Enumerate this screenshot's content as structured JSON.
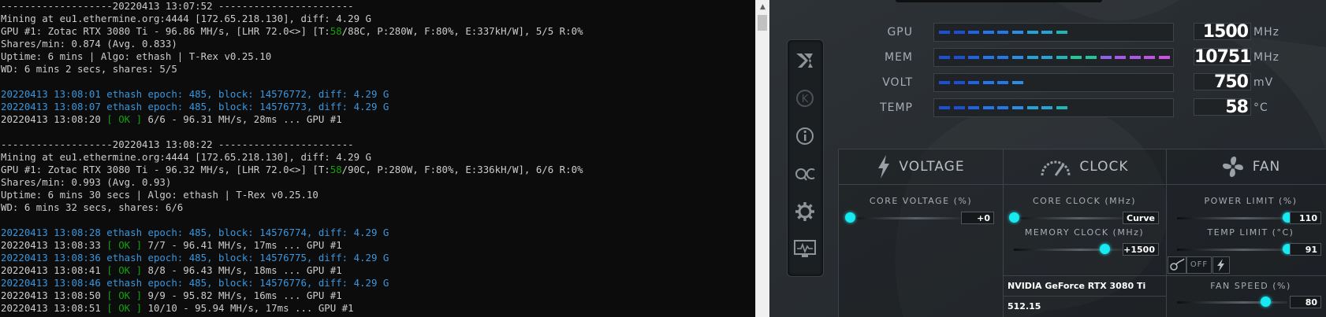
{
  "console": {
    "lines": [
      [
        [
          "w",
          "-------------------"
        ],
        [
          "w",
          "20220413 13:07:52"
        ],
        [
          "w",
          " -----------------------"
        ]
      ],
      [
        [
          "w",
          "Mining at eu1.ethermine.org:4444 [172.65.218.130], diff: 4.29 G"
        ]
      ],
      [
        [
          "w",
          "GPU #1: Zotac RTX 3080 Ti - 96.86 MH/s, [LHR 72.0<>] [T:"
        ],
        [
          "g",
          "58"
        ],
        [
          "w",
          "/88C, P:280W, F:80%, E:337kH/W], 5/5 R:0%"
        ]
      ],
      [
        [
          "w",
          "Shares/min: 0.874 (Avg. 0.833)"
        ]
      ],
      [
        [
          "w",
          "Uptime: 6 mins | Algo: ethash | T-Rex v0.25.10"
        ]
      ],
      [
        [
          "w",
          "WD: 6 mins 2 secs, shares: 5/5"
        ]
      ],
      [
        [
          "w",
          ""
        ]
      ],
      [
        [
          "c",
          "20220413 13:08:01 ethash epoch: 485, block: 14576772, diff: 4.29 G"
        ]
      ],
      [
        [
          "c",
          "20220413 13:08:07 ethash epoch: 485, block: 14576773, diff: 4.29 G"
        ]
      ],
      [
        [
          "w",
          "20220413 13:08:20 "
        ],
        [
          "g",
          "[ OK ]"
        ],
        [
          "w",
          " 6/6 - 96.31 MH/s, 28ms ... GPU #1"
        ]
      ],
      [
        [
          "w",
          ""
        ]
      ],
      [
        [
          "w",
          "-------------------"
        ],
        [
          "w",
          "20220413 13:08:22"
        ],
        [
          "w",
          " -----------------------"
        ]
      ],
      [
        [
          "w",
          "Mining at eu1.ethermine.org:4444 [172.65.218.130], diff: 4.29 G"
        ]
      ],
      [
        [
          "w",
          "GPU #1: Zotac RTX 3080 Ti - 96.32 MH/s, [LHR 72.0<>] [T:"
        ],
        [
          "g",
          "58"
        ],
        [
          "w",
          "/90C, P:280W, F:80%, E:336kH/W], 6/6 R:0%"
        ]
      ],
      [
        [
          "w",
          "Shares/min: 0.993 (Avg. 0.93)"
        ]
      ],
      [
        [
          "w",
          "Uptime: 6 mins 30 secs | Algo: ethash | T-Rex v0.25.10"
        ]
      ],
      [
        [
          "w",
          "WD: 6 mins 32 secs, shares: 6/6"
        ]
      ],
      [
        [
          "w",
          ""
        ]
      ],
      [
        [
          "c",
          "20220413 13:08:28 ethash epoch: 485, block: 14576774, diff: 4.29 G"
        ]
      ],
      [
        [
          "w",
          "20220413 13:08:33 "
        ],
        [
          "g",
          "[ OK ]"
        ],
        [
          "w",
          " 7/7 - 96.41 MH/s, 17ms ... GPU #1"
        ]
      ],
      [
        [
          "c",
          "20220413 13:08:36 ethash epoch: 485, block: 14576775, diff: 4.29 G"
        ]
      ],
      [
        [
          "w",
          "20220413 13:08:41 "
        ],
        [
          "g",
          "[ OK ]"
        ],
        [
          "w",
          " 8/8 - 96.43 MH/s, 18ms ... GPU #1"
        ]
      ],
      [
        [
          "c",
          "20220413 13:08:46 ethash epoch: 485, block: 14576776, diff: 4.29 G"
        ]
      ],
      [
        [
          "w",
          "20220413 13:08:50 "
        ],
        [
          "g",
          "[ OK ]"
        ],
        [
          "w",
          " 9/9 - 95.82 MH/s, 16ms ... GPU #1"
        ]
      ],
      [
        [
          "w",
          "20220413 13:08:51 "
        ],
        [
          "g",
          "[ OK ]"
        ],
        [
          "w",
          " 10/10 - 95.94 MH/s, 17ms ... GPU #1"
        ]
      ]
    ]
  },
  "colors": {
    "console_white": "#cccccc",
    "console_cyan": "#3a96dd",
    "console_green": "#13a10e",
    "accent_cyan": "#18e8f0"
  },
  "meters": [
    {
      "label": "GPU",
      "value": "1500",
      "unit": "MHz",
      "level": 0.58
    },
    {
      "label": "MEM",
      "value": "10751",
      "unit": "MHz",
      "level": 0.98
    },
    {
      "label": "VOLT",
      "value": "750",
      "unit": "mV",
      "level": 0.36
    },
    {
      "label": "TEMP",
      "value": "58",
      "unit": "°C",
      "level": 0.58
    }
  ],
  "panels": {
    "voltage": {
      "title": "VOLTAGE",
      "core_voltage_label": "CORE VOLTAGE (%)",
      "core_voltage_value": "+0",
      "core_voltage_level": 0.0
    },
    "clock": {
      "title": "CLOCK",
      "core_clock_label": "CORE CLOCK (MHz)",
      "core_clock_value": "Curve",
      "core_clock_level": 0.0,
      "memory_clock_label": "MEMORY CLOCK (MHz)",
      "memory_clock_value": "+1500",
      "memory_clock_level": 0.82,
      "gpu_name": "NVIDIA GeForce RTX 3080 Ti",
      "driver": "512.15"
    },
    "fan": {
      "title": "FAN",
      "power_limit_label": "POWER LIMIT (%)",
      "power_limit_value": "110",
      "power_limit_level": 1.0,
      "temp_limit_label": "TEMP LIMIT (°C)",
      "temp_limit_value": "91",
      "temp_limit_level": 1.0,
      "fan_auto_label": "OFF",
      "fan_speed_label": "FAN SPEED (%)",
      "fan_speed_value": "80",
      "fan_speed_level": 0.8
    }
  },
  "sidebar": {
    "items": [
      {
        "icon": "msi-dragon-icon"
      },
      {
        "icon": "kombustor-icon"
      },
      {
        "icon": "info-icon"
      },
      {
        "icon": "oc-scanner-icon"
      },
      {
        "icon": "settings-icon"
      },
      {
        "icon": "monitor-icon"
      }
    ]
  }
}
